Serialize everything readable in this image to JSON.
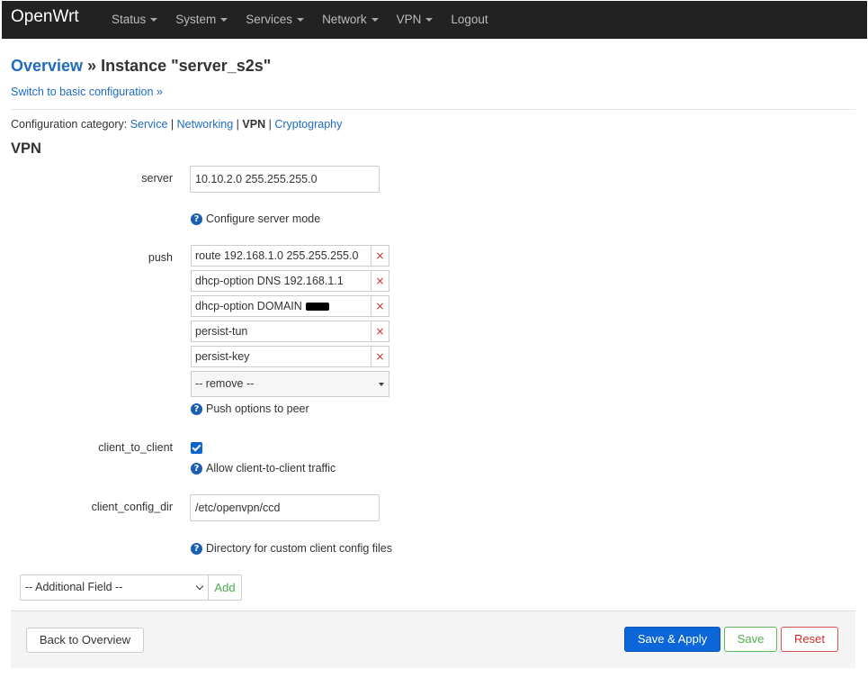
{
  "nav": {
    "brand": "OpenWrt",
    "items": [
      {
        "label": "Status",
        "dropdown": true
      },
      {
        "label": "System",
        "dropdown": true
      },
      {
        "label": "Services",
        "dropdown": true
      },
      {
        "label": "Network",
        "dropdown": true
      },
      {
        "label": "VPN",
        "dropdown": true
      },
      {
        "label": "Logout",
        "dropdown": false
      }
    ]
  },
  "header": {
    "overview_link": "Overview",
    "separator": "»",
    "title": "Instance \"server_s2s\"",
    "basic_link": "Switch to basic configuration »"
  },
  "categories": {
    "prefix": "Configuration category:",
    "items": [
      "Service",
      "Networking",
      "VPN",
      "Cryptography"
    ],
    "active": "VPN",
    "sep": "|"
  },
  "section": {
    "title": "VPN"
  },
  "fields": {
    "server": {
      "label": "server",
      "value": "10.10.2.0 255.255.255.0",
      "hint": "Configure server mode"
    },
    "push": {
      "label": "push",
      "values": [
        "route 192.168.1.0 255.255.255.0",
        "dhcp-option DNS 192.168.1.1",
        "dhcp-option DOMAIN ",
        "persist-tun",
        "persist-key"
      ],
      "remove_symbol": "×",
      "remove_select": "-- remove --",
      "hint": "Push options to peer"
    },
    "client_to_client": {
      "label": "client_to_client",
      "checked": true,
      "hint": "Allow client-to-client traffic"
    },
    "client_config_dir": {
      "label": "client_config_dir",
      "value": "/etc/openvpn/ccd",
      "hint": "Directory for custom client config files"
    }
  },
  "additional": {
    "select": "-- Additional Field --",
    "add": "Add"
  },
  "footer": {
    "back": "Back to Overview",
    "save_apply": "Save & Apply",
    "save": "Save",
    "reset": "Reset"
  },
  "colors": {
    "accent": "#0b66d9",
    "link": "#1e6bbf",
    "navbar": "#222222",
    "success": "#4cae4c",
    "danger": "#c9302c"
  },
  "icons": {
    "help": "question-circle-icon",
    "remove": "x-icon",
    "dropdown": "caret-down-icon"
  }
}
